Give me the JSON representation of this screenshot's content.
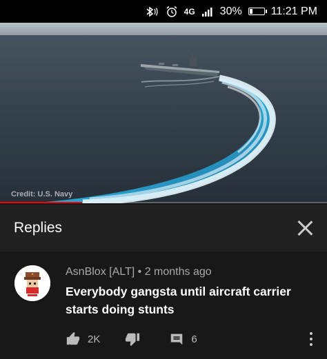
{
  "status_bar": {
    "network": "4G",
    "battery": "30%",
    "battery_level": 0.3,
    "time": "11:21 PM",
    "icons": [
      "bluetooth-icon",
      "alarm-icon",
      "signal-icon",
      "battery-icon"
    ]
  },
  "video": {
    "credit": "Credit: U.S. Navy",
    "progress": 0.25,
    "accent_color": "#ff0000"
  },
  "replies_panel": {
    "title": "Replies",
    "close_icon": "close-icon"
  },
  "comment": {
    "author": "AsnBlox [ALT]",
    "separator": "•",
    "age": "2 months ago",
    "text": "Everybody gangsta until aircraft carrier starts doing stunts",
    "likes": "2K",
    "replies": "6",
    "icons": [
      "thumbs-up-icon",
      "thumbs-down-icon",
      "reply-icon",
      "more-vert-icon"
    ]
  }
}
